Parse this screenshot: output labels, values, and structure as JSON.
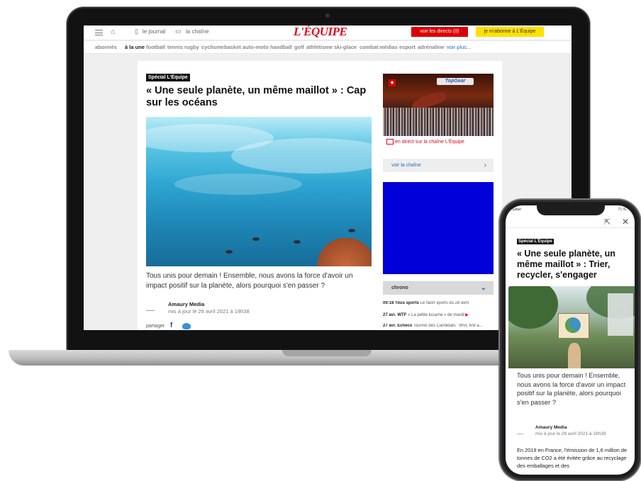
{
  "desktop": {
    "header": {
      "journal_label": "le journal",
      "channel_label": "la chaîne",
      "logo": "L'ÉQUIPE",
      "direct_button": "voir les directs (0)",
      "subscribe_button": "je m'abonne à L'Équipe"
    },
    "nav": {
      "items": [
        "abonnés",
        "à la une",
        "football",
        "tennis",
        "rugby",
        "cyclisme",
        "basket",
        "auto-moto",
        "handball",
        "golf",
        "athlétisme",
        "ski-glace",
        "combat",
        "médias",
        "esport",
        "adrénaline"
      ],
      "more": "voir plus..."
    },
    "article": {
      "tag": "Spécial L'Équipe",
      "headline": "« Une seule planète, un même maillot » : Cap sur les océans",
      "summary": "Tous unis pour demain ! Ensemble, nous avons la force d'avoir un impact positif sur la planète, alors pourquoi s'en passer ?",
      "author": "Amaury Media",
      "date": "mis à jour le 26 avril 2021 à 18h38",
      "share_label": "partager"
    },
    "sidebar": {
      "tv_logo": "TopGear",
      "live_link": "en direct sur la chaîne L'Équipe",
      "see_channel": "voir la chaîne",
      "chrono_label": "chrono",
      "chrono_items": [
        {
          "time": "09:18",
          "category": "Tous sports",
          "text": "Le flash sports du 28 avril"
        },
        {
          "time": "27 avr.",
          "category": "WTF",
          "text": "« La petite lucarne » de mardi"
        },
        {
          "time": "27 avr.",
          "category": "Échecs",
          "text": "Tournoi des Candidats : MVL finit a..."
        }
      ]
    }
  },
  "mobile": {
    "status_left": "Safari",
    "status_right": "71 %",
    "article": {
      "tag": "Spécial L'Équipe",
      "headline": "« Une seule planète, un même maillot » : Trier, recycler, s'engager",
      "summary": "Tous unis pour demain ! Ensemble, nous avons la force d'avoir un impact positif sur la planète, alors pourquoi s'en passer ?",
      "author": "Amaury Media",
      "date": "mis à jour le 26 avril 2021 à 18h39",
      "body": "En 2019 en France, l'émission de 1,6 million de tonnes de CO2 a été évitée grâce au recyclage des emballages et des"
    }
  },
  "colors": {
    "brand_red": "#e2061b",
    "subscribe_yellow": "#ffe100",
    "ad_blue": "#0000d8"
  }
}
